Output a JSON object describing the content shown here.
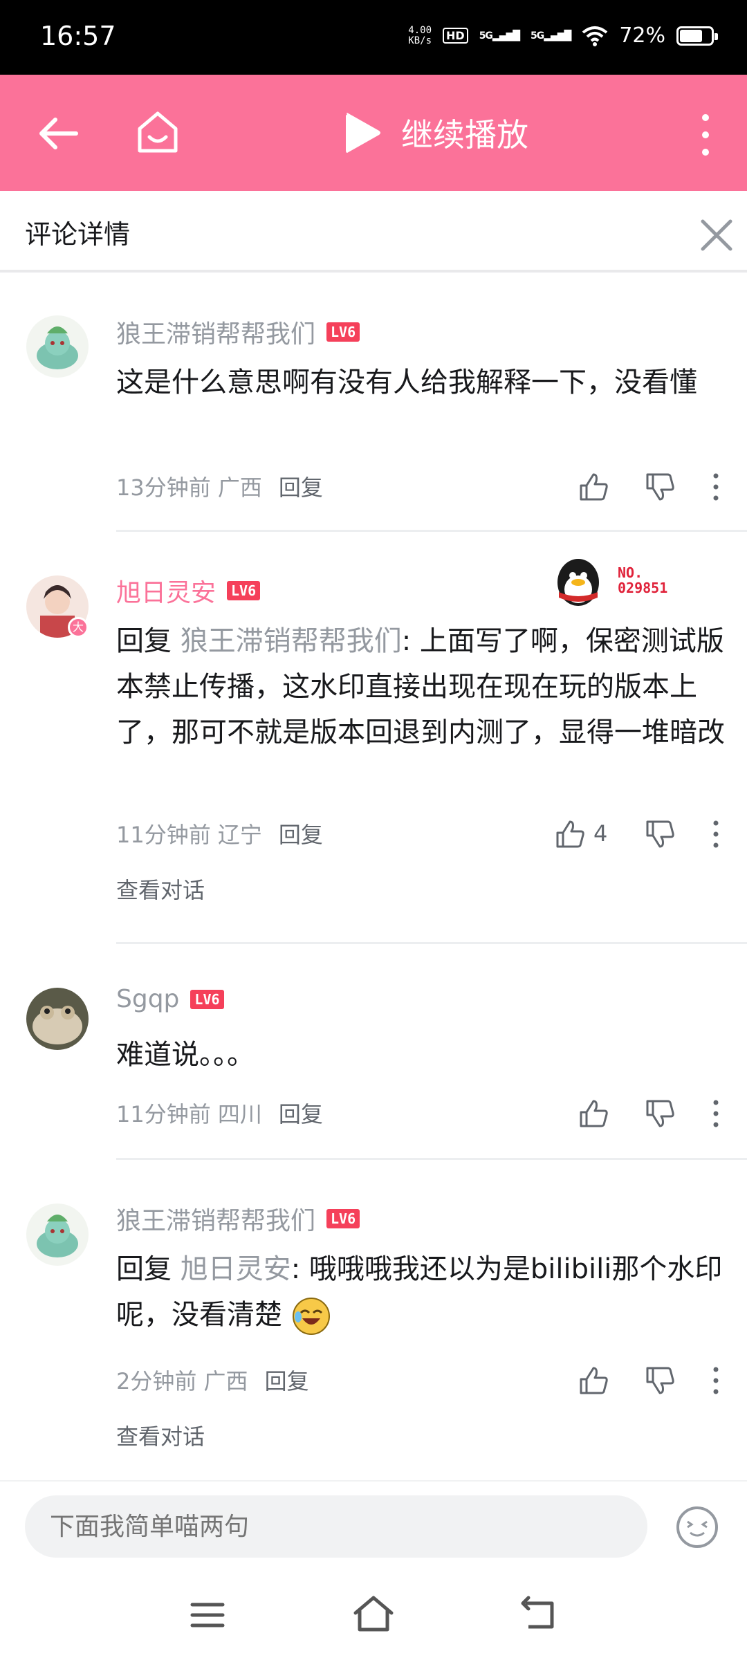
{
  "status": {
    "time": "16:57",
    "netspeed_top": "4.00",
    "netspeed_unit": "KB/s",
    "hd": "HD",
    "sig1": "5G",
    "sig2": "5G",
    "battery": "72%",
    "battery_level": 0.72
  },
  "topbar": {
    "play_label": "继续播放"
  },
  "detail": {
    "title": "评论详情"
  },
  "comments": [
    {
      "user": "狼王滞销帮帮我们",
      "level": "LV6",
      "text": "这是什么意思啊有没有人给我解释一下，没看懂",
      "time": "13分钟前",
      "location": "广西",
      "reply": "回复",
      "likes": ""
    },
    {
      "user": "旭日灵安",
      "level": "LV6",
      "reply_prefix": "回复 ",
      "reply_to": "狼王滞销帮帮我们",
      "text": ": 上面写了啊，保密测试版本禁止传播，这水印直接出现在现在玩的版本上了，那可不就是版本回退到内测了，显得一堆暗改",
      "time": "11分钟前",
      "location": "辽宁",
      "reply": "回复",
      "likes": "4",
      "view_conversation": "查看对话",
      "badge_no": "NO.",
      "badge_num": "029851"
    },
    {
      "user": "Sgqp",
      "level": "LV6",
      "text": "难道说。。。",
      "time": "11分钟前",
      "location": "四川",
      "reply": "回复",
      "likes": ""
    },
    {
      "user": "狼王滞销帮帮我们",
      "level": "LV6",
      "reply_prefix": "回复 ",
      "reply_to": "旭日灵安",
      "text": ": 哦哦哦我还以为是bilibili那个水印呢，没看清楚",
      "time": "2分钟前",
      "location": "广西",
      "reply": "回复",
      "likes": "",
      "view_conversation": "查看对话"
    }
  ],
  "input": {
    "placeholder": "下面我简单喵两句"
  },
  "colors": {
    "accent": "#fb7299",
    "level_badge": "#f5405a",
    "gray_text": "#9499a0"
  }
}
